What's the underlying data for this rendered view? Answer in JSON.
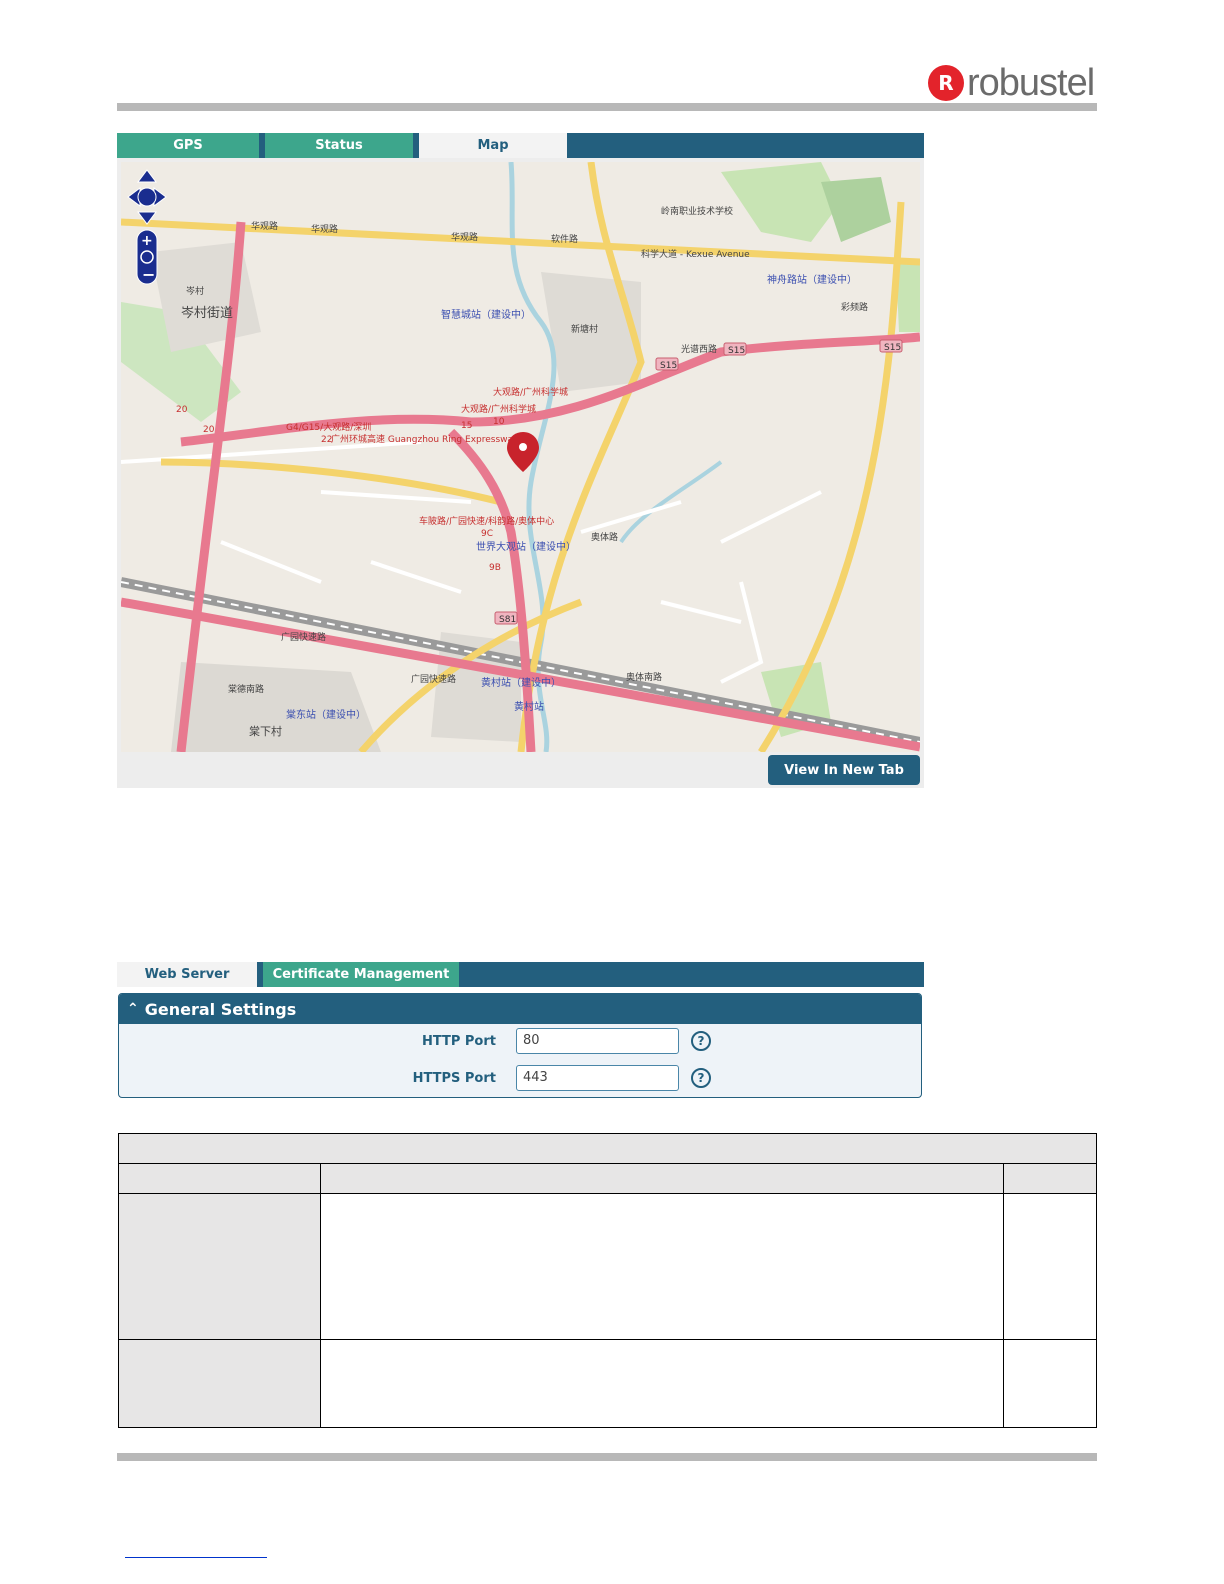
{
  "brand": {
    "name": "robustel",
    "logo_letter": "R",
    "accent": "#e3232b"
  },
  "gps_tabs": [
    {
      "label": "GPS",
      "active": false
    },
    {
      "label": "Status",
      "active": false
    },
    {
      "label": "Map",
      "active": true
    }
  ],
  "map": {
    "labels": {
      "huaguan_road": "华观路",
      "cencun": "岑村",
      "cencun_street": "岑村街道",
      "zhihuicheng": "智慧城站（建设中）",
      "xintangcun": "新塘村",
      "kexue_avenue": "科学大道 - Kexue Avenue",
      "shenzhou_station": "神舟路站（建设中）",
      "caipin_road": "彩频路",
      "guangzhou_ring": "广州环城高速 Guangzhou Ring Expressway",
      "g4_label": "G4/G15/大观路/深圳",
      "daguan_road": "大观路/广州科学城",
      "daguan_road_2": "大观路/广州科学城",
      "world_daguan": "世界大观站（建设中）",
      "chebei_road": "车陂路/广园快速/科韵路/奥体中心",
      "aoti_road": "奥体路",
      "huangcun_station": "黄村站（建设中）",
      "huangcun": "黄村站",
      "aoti_south": "奥体南路",
      "guangyuan_expressway": "广园快速路",
      "tangdong_station": "棠东站（建设中）",
      "tangxia": "棠下村",
      "tangde_road": "棠德南路",
      "lingnan_school": "岭南职业技术学校",
      "guangtang_road": "光谱西路",
      "ruanjian_road": "软件路",
      "s15": "S15",
      "s81": "S81",
      "n10": "10",
      "n15": "15",
      "n20": "20",
      "n22": "22",
      "n9c": "9C",
      "n9b": "9B"
    },
    "view_new_tab_label": "View In New Tab"
  },
  "web_tabs": [
    {
      "label": "Web Server",
      "active": true
    },
    {
      "label": "Certificate Management",
      "active": false
    }
  ],
  "general_settings": {
    "title": "General Settings",
    "fields": [
      {
        "label": "HTTP Port",
        "value": "80"
      },
      {
        "label": "HTTPS Port",
        "value": "443"
      }
    ],
    "help_glyph": "?"
  },
  "colors": {
    "primary": "#235f7e",
    "tab_green": "#3da68c",
    "panel_bg": "#eef3f8"
  }
}
